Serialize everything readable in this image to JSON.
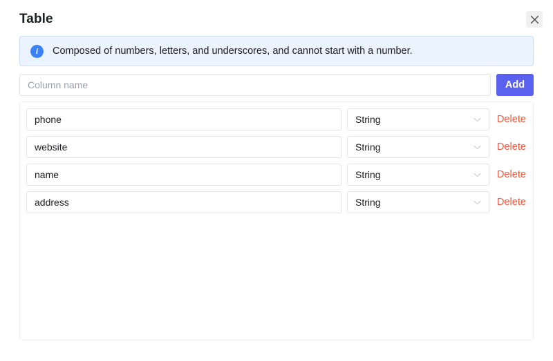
{
  "dialog": {
    "title": "Table",
    "close_icon": "close-icon"
  },
  "info_banner": {
    "icon": "info-circle-icon",
    "text": "Composed of numbers, letters, and underscores, and cannot start with a number."
  },
  "add_row": {
    "input_value": "",
    "input_placeholder": "Column name",
    "add_label": "Add"
  },
  "columns_table": {
    "delete_label": "Delete",
    "chevron_icon": "chevron-down-icon",
    "rows": [
      {
        "name": "phone",
        "type": "String"
      },
      {
        "name": "website",
        "type": "String"
      },
      {
        "name": "name",
        "type": "String"
      },
      {
        "name": "address",
        "type": "String"
      }
    ]
  },
  "colors": {
    "accent": "#5a61ef",
    "danger": "#f4553d",
    "info_bg": "#ebf3fe",
    "info_border": "#c9defc",
    "info_icon": "#3b82f6",
    "border": "#e3e4e8",
    "text": "#1b1d21",
    "placeholder": "#9aa0ae"
  }
}
